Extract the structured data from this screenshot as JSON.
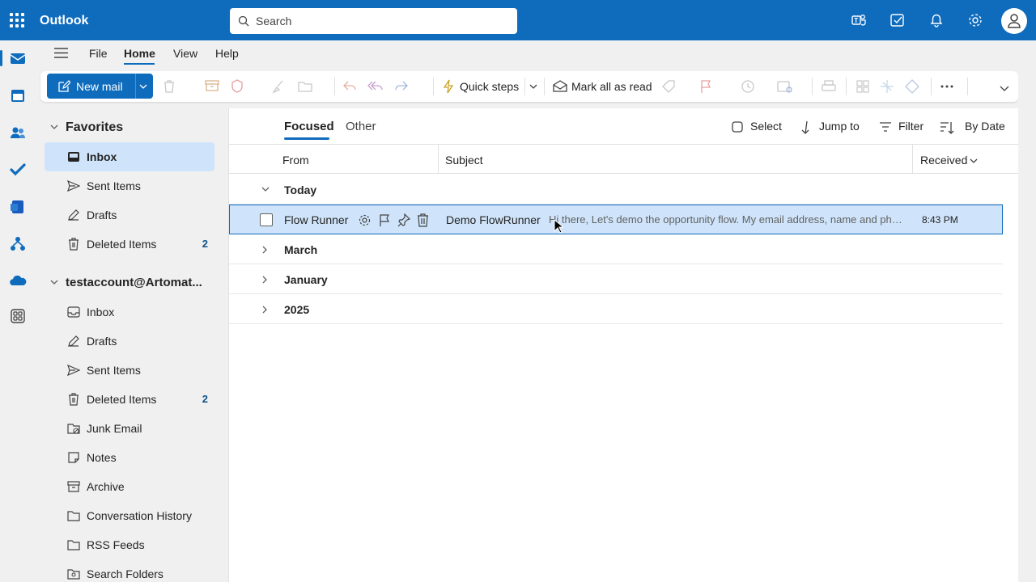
{
  "app": {
    "title": "Outlook"
  },
  "search": {
    "placeholder": "Search"
  },
  "menu": {
    "file": "File",
    "home": "Home",
    "view": "View",
    "help": "Help"
  },
  "toolbar": {
    "new_mail": "New mail",
    "quick_steps": "Quick steps",
    "mark_all_read": "Mark all as read"
  },
  "favorites": {
    "header": "Favorites",
    "items": [
      {
        "label": "Inbox",
        "icon": "inbox-icon"
      },
      {
        "label": "Sent Items",
        "icon": "send-icon"
      },
      {
        "label": "Drafts",
        "icon": "pencil-icon"
      },
      {
        "label": "Deleted Items",
        "icon": "trash-icon",
        "count": "2"
      }
    ]
  },
  "account": {
    "header": "testaccount@Artomat...",
    "items": [
      {
        "label": "Inbox",
        "icon": "inbox-icon"
      },
      {
        "label": "Drafts",
        "icon": "pencil-icon"
      },
      {
        "label": "Sent Items",
        "icon": "send-icon"
      },
      {
        "label": "Deleted Items",
        "icon": "trash-icon",
        "count": "2"
      },
      {
        "label": "Junk Email",
        "icon": "junk-icon"
      },
      {
        "label": "Notes",
        "icon": "note-icon"
      },
      {
        "label": "Archive",
        "icon": "archive-icon"
      },
      {
        "label": "Conversation History",
        "icon": "folder-icon"
      },
      {
        "label": "RSS Feeds",
        "icon": "folder-icon"
      },
      {
        "label": "Search Folders",
        "icon": "search-folder-icon"
      }
    ]
  },
  "list": {
    "tabs": {
      "focused": "Focused",
      "other": "Other"
    },
    "actions": {
      "select": "Select",
      "jump_to": "Jump to",
      "filter": "Filter",
      "sort": "By Date"
    },
    "columns": {
      "from": "From",
      "subject": "Subject",
      "received": "Received"
    },
    "groups": {
      "today": "Today",
      "march": "March",
      "january": "January",
      "y2025": "2025"
    },
    "message": {
      "from": "Flow Runner",
      "subject": "Demo FlowRunner",
      "preview": "Hi there, Let's demo the opportunity flow. My email address, name and phone number are included below.",
      "time": "8:43 PM"
    }
  },
  "colors": {
    "brand": "#0f6cbd",
    "selected": "#cfe4fa"
  }
}
